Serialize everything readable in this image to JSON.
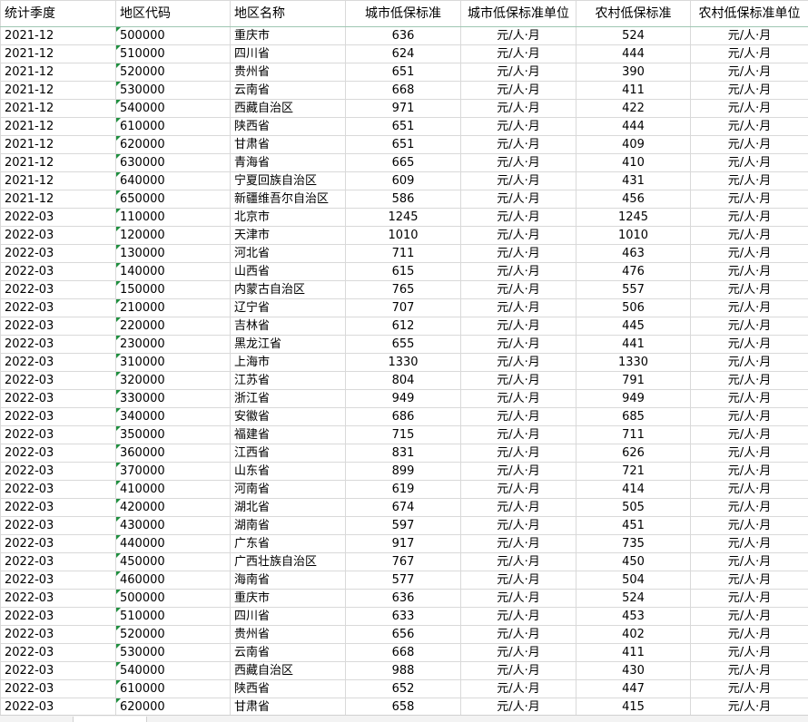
{
  "columns": [
    "统计季度",
    "地区代码",
    "地区名称",
    "城市低保标准",
    "城市低保标准单位",
    "农村低保标准",
    "农村低保标准单位"
  ],
  "rows": [
    [
      "2021-12",
      "500000",
      "重庆市",
      "636",
      "元/人·月",
      "524",
      "元/人·月"
    ],
    [
      "2021-12",
      "510000",
      "四川省",
      "624",
      "元/人·月",
      "444",
      "元/人·月"
    ],
    [
      "2021-12",
      "520000",
      "贵州省",
      "651",
      "元/人·月",
      "390",
      "元/人·月"
    ],
    [
      "2021-12",
      "530000",
      "云南省",
      "668",
      "元/人·月",
      "411",
      "元/人·月"
    ],
    [
      "2021-12",
      "540000",
      "西藏自治区",
      "971",
      "元/人·月",
      "422",
      "元/人·月"
    ],
    [
      "2021-12",
      "610000",
      "陕西省",
      "651",
      "元/人·月",
      "444",
      "元/人·月"
    ],
    [
      "2021-12",
      "620000",
      "甘肃省",
      "651",
      "元/人·月",
      "409",
      "元/人·月"
    ],
    [
      "2021-12",
      "630000",
      "青海省",
      "665",
      "元/人·月",
      "410",
      "元/人·月"
    ],
    [
      "2021-12",
      "640000",
      "宁夏回族自治区",
      "609",
      "元/人·月",
      "431",
      "元/人·月"
    ],
    [
      "2021-12",
      "650000",
      "新疆维吾尔自治区",
      "586",
      "元/人·月",
      "456",
      "元/人·月"
    ],
    [
      "2022-03",
      "110000",
      "北京市",
      "1245",
      "元/人·月",
      "1245",
      "元/人·月"
    ],
    [
      "2022-03",
      "120000",
      "天津市",
      "1010",
      "元/人·月",
      "1010",
      "元/人·月"
    ],
    [
      "2022-03",
      "130000",
      "河北省",
      "711",
      "元/人·月",
      "463",
      "元/人·月"
    ],
    [
      "2022-03",
      "140000",
      "山西省",
      "615",
      "元/人·月",
      "476",
      "元/人·月"
    ],
    [
      "2022-03",
      "150000",
      "内蒙古自治区",
      "765",
      "元/人·月",
      "557",
      "元/人·月"
    ],
    [
      "2022-03",
      "210000",
      "辽宁省",
      "707",
      "元/人·月",
      "506",
      "元/人·月"
    ],
    [
      "2022-03",
      "220000",
      "吉林省",
      "612",
      "元/人·月",
      "445",
      "元/人·月"
    ],
    [
      "2022-03",
      "230000",
      "黑龙江省",
      "655",
      "元/人·月",
      "441",
      "元/人·月"
    ],
    [
      "2022-03",
      "310000",
      "上海市",
      "1330",
      "元/人·月",
      "1330",
      "元/人·月"
    ],
    [
      "2022-03",
      "320000",
      "江苏省",
      "804",
      "元/人·月",
      "791",
      "元/人·月"
    ],
    [
      "2022-03",
      "330000",
      "浙江省",
      "949",
      "元/人·月",
      "949",
      "元/人·月"
    ],
    [
      "2022-03",
      "340000",
      "安徽省",
      "686",
      "元/人·月",
      "685",
      "元/人·月"
    ],
    [
      "2022-03",
      "350000",
      "福建省",
      "715",
      "元/人·月",
      "711",
      "元/人·月"
    ],
    [
      "2022-03",
      "360000",
      "江西省",
      "831",
      "元/人·月",
      "626",
      "元/人·月"
    ],
    [
      "2022-03",
      "370000",
      "山东省",
      "899",
      "元/人·月",
      "721",
      "元/人·月"
    ],
    [
      "2022-03",
      "410000",
      "河南省",
      "619",
      "元/人·月",
      "414",
      "元/人·月"
    ],
    [
      "2022-03",
      "420000",
      "湖北省",
      "674",
      "元/人·月",
      "505",
      "元/人·月"
    ],
    [
      "2022-03",
      "430000",
      "湖南省",
      "597",
      "元/人·月",
      "451",
      "元/人·月"
    ],
    [
      "2022-03",
      "440000",
      "广东省",
      "917",
      "元/人·月",
      "735",
      "元/人·月"
    ],
    [
      "2022-03",
      "450000",
      "广西壮族自治区",
      "767",
      "元/人·月",
      "450",
      "元/人·月"
    ],
    [
      "2022-03",
      "460000",
      "海南省",
      "577",
      "元/人·月",
      "504",
      "元/人·月"
    ],
    [
      "2022-03",
      "500000",
      "重庆市",
      "636",
      "元/人·月",
      "524",
      "元/人·月"
    ],
    [
      "2022-03",
      "510000",
      "四川省",
      "633",
      "元/人·月",
      "453",
      "元/人·月"
    ],
    [
      "2022-03",
      "520000",
      "贵州省",
      "656",
      "元/人·月",
      "402",
      "元/人·月"
    ],
    [
      "2022-03",
      "530000",
      "云南省",
      "668",
      "元/人·月",
      "411",
      "元/人·月"
    ],
    [
      "2022-03",
      "540000",
      "西藏自治区",
      "988",
      "元/人·月",
      "430",
      "元/人·月"
    ],
    [
      "2022-03",
      "610000",
      "陕西省",
      "652",
      "元/人·月",
      "447",
      "元/人·月"
    ],
    [
      "2022-03",
      "620000",
      "甘肃省",
      "658",
      "元/人·月",
      "415",
      "元/人·月"
    ]
  ],
  "colors": {
    "grid": "#d9d9d9",
    "header_rule": "#9fc7b2",
    "text_marker": "#1f8f3f"
  }
}
